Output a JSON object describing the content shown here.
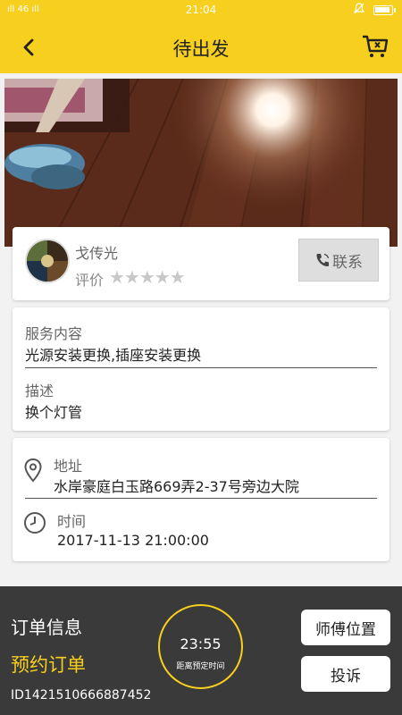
{
  "status_bar": {
    "signal": "ıll 46 ıll",
    "time": "21:04"
  },
  "header": {
    "title": "待出发",
    "back_icon": "chevron-left-icon",
    "cart_icon": "cart-cancel-icon"
  },
  "master": {
    "name": "戈传光",
    "rating_label": "评价",
    "rating_stars": 5,
    "rating_filled": 0,
    "stars": "★★★★★",
    "contact_label": "联系"
  },
  "service": {
    "content_label": "服务内容",
    "content_value": "光源安装更换,插座安装更换",
    "desc_label": "描述",
    "desc_value": "换个灯管"
  },
  "location": {
    "address_label": "地址",
    "address_value": "水岸豪庭白玉路669弄2-37号旁边大院",
    "time_label": "时间",
    "time_value": "2017-11-13 21:00:00"
  },
  "order": {
    "title": "订单信息",
    "type": "预约订单",
    "id": "ID1421510666887452",
    "countdown": "23:55",
    "countdown_caption": "距离预定时间",
    "btn_location": "师傅位置",
    "btn_complain": "投诉"
  },
  "colors": {
    "accent": "#f7cf1e",
    "bottom_bar": "#3a3a3a"
  }
}
